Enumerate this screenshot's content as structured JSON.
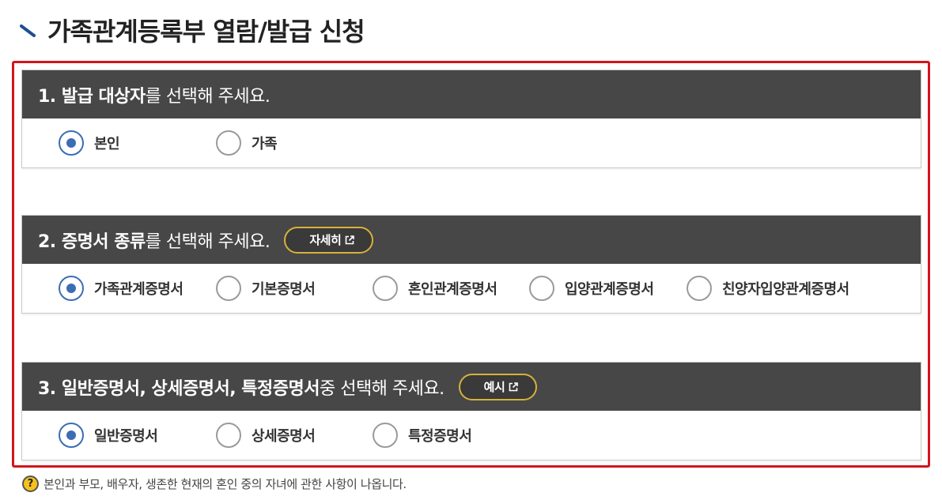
{
  "page": {
    "title": "가족관계등록부 열람/발급 신청"
  },
  "section1": {
    "heading_strong": "1. 발급 대상자",
    "heading_rest": "를 선택해 주세요.",
    "options": [
      {
        "label": "본인",
        "checked": true
      },
      {
        "label": "가족",
        "checked": false
      }
    ]
  },
  "section2": {
    "heading_strong": "2. 증명서 종류",
    "heading_rest": "를 선택해 주세요.",
    "detail_button": "자세히",
    "options": [
      {
        "label": "가족관계증명서",
        "checked": true
      },
      {
        "label": "기본증명서",
        "checked": false
      },
      {
        "label": "혼인관계증명서",
        "checked": false
      },
      {
        "label": "입양관계증명서",
        "checked": false
      },
      {
        "label": "친양자입양관계증명서",
        "checked": false
      }
    ]
  },
  "section3": {
    "heading_strong": "3. 일반증명서, 상세증명서, 특정증명서",
    "heading_rest": " 중 선택해 주세요.",
    "example_button": "예시",
    "options": [
      {
        "label": "일반증명서",
        "checked": true
      },
      {
        "label": "상세증명서",
        "checked": false
      },
      {
        "label": "특정증명서",
        "checked": false
      }
    ]
  },
  "note": {
    "icon": "question-icon",
    "text": "본인과 부모, 배우자, 생존한 현재의 혼인 중의 자녀에 관한 사항이 나옵니다."
  },
  "colors": {
    "accent": "#3b6db4",
    "frame": "#d4141b",
    "header_bg": "#474747",
    "button_border": "#d7b23a"
  }
}
